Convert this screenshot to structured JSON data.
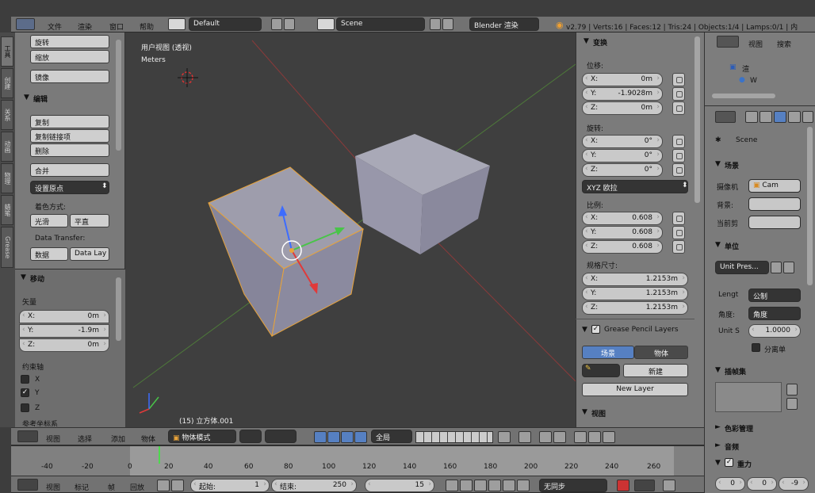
{
  "menubar": {
    "items": [
      "文件",
      "渲染",
      "窗口",
      "帮助"
    ],
    "layout": "Default",
    "scene": "Scene",
    "engine": "Blender 渲染",
    "stats": "v2.79 | Verts:16 | Faces:12 | Tris:24 | Objects:1/4 | Lamps:0/1 | 内"
  },
  "left_tabs": [
    "工具",
    "创建",
    "关系",
    "动画",
    "物理",
    "蜡笔",
    "Grease"
  ],
  "tools": {
    "buttons_top": [
      "旋转",
      "缩放",
      "镜像"
    ],
    "edit_header": "编辑",
    "edit_buttons": [
      "复制",
      "复制链接项",
      "删除",
      "合并"
    ],
    "set_origin": "设置原点",
    "shading_label": "着色方式:",
    "smooth": "光滑",
    "flat": "平直",
    "data_transfer": "Data Transfer:",
    "data": "数据",
    "data_lay": "Data Lay"
  },
  "operator": {
    "header": "移动",
    "vector": "矢量",
    "x_label": "X:",
    "x_value": "0m",
    "y_label": "Y:",
    "y_value": "-1.9m",
    "z_label": "Z:",
    "z_value": "0m",
    "constraint": "约束轴",
    "axes": [
      "X",
      "Y",
      "Z"
    ],
    "orientation": "参考坐标系"
  },
  "viewport": {
    "view_name": "用户视图 (透视)",
    "units": "Meters",
    "object_name": "(15) 立方体.001"
  },
  "transform": {
    "header": "变换",
    "location": "位移:",
    "loc": [
      [
        "X:",
        "0m"
      ],
      [
        "Y:",
        "-1.9028m"
      ],
      [
        "Z:",
        "0m"
      ]
    ],
    "rotation": "旋转:",
    "rot": [
      [
        "X:",
        "0°"
      ],
      [
        "Y:",
        "0°"
      ],
      [
        "Z:",
        "0°"
      ]
    ],
    "rot_mode": "XYZ 欧拉",
    "scale": "比例:",
    "scl": [
      [
        "X:",
        "0.608"
      ],
      [
        "Y:",
        "0.608"
      ],
      [
        "Z:",
        "0.608"
      ]
    ],
    "dimensions": "规格尺寸:",
    "dim": [
      [
        "X:",
        "1.2153m"
      ],
      [
        "Y:",
        "1.2153m"
      ],
      [
        "Z:",
        "1.2153m"
      ]
    ],
    "gp_header": "Grease Pencil Layers",
    "scene_tab": "场景",
    "object_tab": "物体",
    "new": "新建",
    "new_layer": "New Layer",
    "view_header": "视图"
  },
  "outliner": {
    "view": "视图",
    "search": "搜索",
    "item1": "渲",
    "item2": "W"
  },
  "properties": {
    "scene": "Scene",
    "scene_header": "场景",
    "camera_label": "摄像机",
    "camera": "Cam",
    "background": "背景:",
    "active_clip": "当前剪",
    "units_header": "单位",
    "unit_preset": "Unit Pres...",
    "length_label": "Lengt",
    "length": "公制",
    "angle_label": "角度:",
    "angle": "角度",
    "unit_scale_label": "Unit S",
    "unit_scale": "1.0000",
    "separate": "分离单",
    "keying_header": "插帧集",
    "color_mgmt": "色彩管理",
    "audio": "音频",
    "gravity": "重力",
    "grav_values": [
      "0",
      "0",
      "-9"
    ]
  },
  "view3d_header": {
    "view": "视图",
    "select": "选择",
    "add": "添加",
    "object": "物体",
    "mode": "物体模式",
    "global": "全局"
  },
  "timeline": {
    "ticks": [
      "-40",
      "-20",
      "0",
      "20",
      "40",
      "60",
      "80",
      "100",
      "120",
      "140",
      "160",
      "180",
      "200",
      "220",
      "240",
      "260"
    ],
    "view": "视图",
    "marker": "标记",
    "frame": "帧",
    "playback": "回放",
    "start_label": "起始:",
    "start": "1",
    "end_label": "结束:",
    "end": "250",
    "current": "15",
    "sync": "无同步"
  }
}
